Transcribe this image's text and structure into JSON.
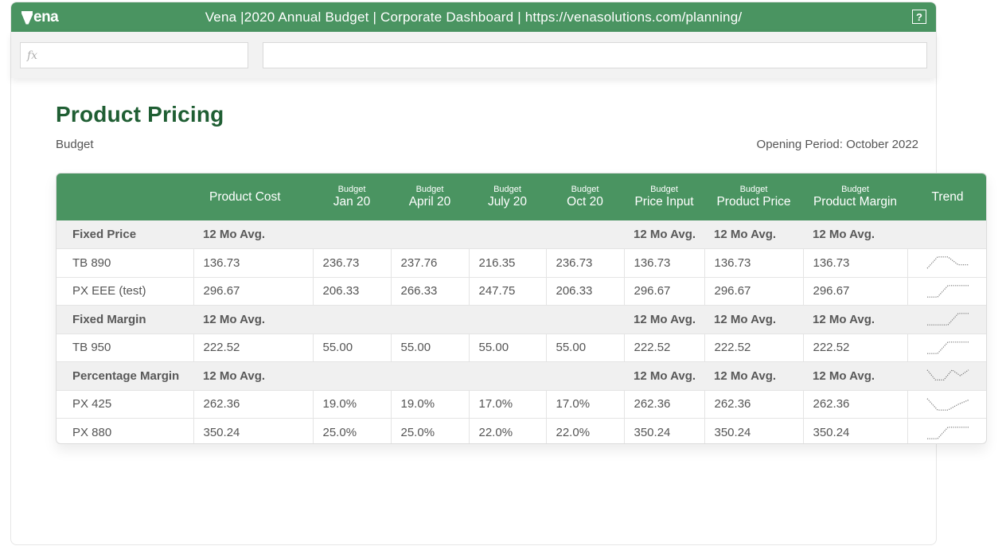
{
  "app": {
    "logo_text": "ena",
    "window_title": "Vena |2020 Annual Budget | Corporate Dashboard | https://venasolutions.com/planning/",
    "help_label": "?",
    "formula_placeholder": "fx",
    "cell_value": ""
  },
  "page": {
    "title": "Product Pricing",
    "subtitle": "Budget",
    "opening_period": "Opening Period: October 2022"
  },
  "colors": {
    "brand_green": "#4a9461",
    "title_green": "#1f5e33",
    "group_row_bg": "#f0f0f0"
  },
  "table": {
    "headers": [
      {
        "small": "",
        "big": ""
      },
      {
        "small": "",
        "big": "Product Cost"
      },
      {
        "small": "Budget",
        "big": "Jan 20"
      },
      {
        "small": "Budget",
        "big": "April 20"
      },
      {
        "small": "Budget",
        "big": "July 20"
      },
      {
        "small": "Budget",
        "big": "Oct 20"
      },
      {
        "small": "Budget",
        "big": "Price Input"
      },
      {
        "small": "Budget",
        "big": "Product Price"
      },
      {
        "small": "Budget",
        "big": "Product Margin"
      },
      {
        "small": "",
        "big": "Trend"
      }
    ],
    "rows": [
      {
        "type": "group",
        "cells": [
          "Fixed Price",
          "12 Mo Avg.",
          "",
          "",
          "",
          "",
          "12 Mo Avg.",
          "12 Mo Avg.",
          "12 Mo Avg."
        ],
        "trend": null
      },
      {
        "type": "item",
        "cells": [
          "TB 890",
          "136.73",
          "236.73",
          "237.76",
          "216.35",
          "236.73",
          "136.73",
          "136.73",
          "136.73"
        ],
        "trend": [
          0.1,
          0.9,
          0.9,
          0.35,
          0.35
        ]
      },
      {
        "type": "item",
        "cells": [
          "PX EEE (test)",
          "296.67",
          "206.33",
          "266.33",
          "247.75",
          "206.33",
          "296.67",
          "296.67",
          "296.67"
        ],
        "trend": [
          0.1,
          0.1,
          0.9,
          0.9,
          0.9
        ]
      },
      {
        "type": "group",
        "cells": [
          "Fixed Margin",
          "12 Mo Avg.",
          "",
          "",
          "",
          "",
          "12 Mo Avg.",
          "12 Mo Avg.",
          "12 Mo Avg."
        ],
        "trend": [
          0.1,
          0.1,
          0.1,
          0.9,
          0.9
        ]
      },
      {
        "type": "item",
        "cells": [
          "TB 950",
          "222.52",
          "55.00",
          "55.00",
          "55.00",
          "55.00",
          "222.52",
          "222.52",
          "222.52"
        ],
        "trend": [
          0.1,
          0.1,
          0.9,
          0.9,
          0.9
        ]
      },
      {
        "type": "group",
        "cells": [
          "Percentage Margin",
          "12 Mo Avg.",
          "",
          "",
          "",
          "",
          "12 Mo Avg.",
          "12 Mo Avg.",
          "12 Mo Avg."
        ],
        "trend": [
          0.9,
          0.2,
          0.2,
          0.9,
          0.5,
          0.9
        ]
      },
      {
        "type": "item",
        "cells": [
          "PX 425",
          "262.36",
          "19.0%",
          "19.0%",
          "17.0%",
          "17.0%",
          "262.36",
          "262.36",
          "262.36"
        ],
        "trend": [
          0.9,
          0.1,
          0.1,
          0.5,
          0.8
        ]
      },
      {
        "type": "item",
        "cells": [
          "PX 880",
          "350.24",
          "25.0%",
          "25.0%",
          "22.0%",
          "22.0%",
          "350.24",
          "350.24",
          "350.24"
        ],
        "trend": [
          0.1,
          0.1,
          0.9,
          0.9,
          0.9
        ]
      }
    ]
  }
}
